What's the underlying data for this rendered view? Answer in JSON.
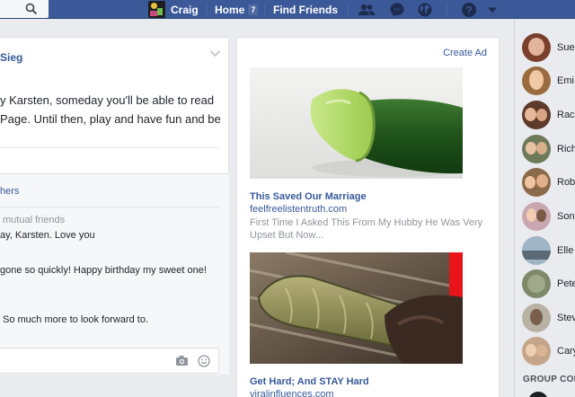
{
  "topbar": {
    "user_name": "Craig",
    "home_label": "Home",
    "home_count": "7",
    "find_friends_label": "Find Friends",
    "icons": [
      "search-icon",
      "friend-requests-icon",
      "messenger-icon",
      "notifications-globe-icon",
      "help-icon",
      "caret-down-icon"
    ]
  },
  "post": {
    "author": "Sieg",
    "text_line1": "y Karsten, someday you'll be able to read",
    "text_line2": "Page. Until then, play and have fun and be",
    "others_link": "hers",
    "mutual_friends": "mutual friends",
    "comments": [
      "ay, Karsten. Love you",
      "gone so quickly! Happy birthday my sweet one!",
      "So much more to look forward to."
    ]
  },
  "ads": {
    "create_ad_label": "Create Ad",
    "items": [
      {
        "title": "This Saved Our Marriage",
        "url": "feelfreelistentruth.com",
        "description": "First Time I Asked This From My Hubby He Was Very Upset But Now..."
      },
      {
        "title": "Get Hard; And STAY Hard",
        "url": "viralinfluences.com"
      }
    ]
  },
  "sidebar": {
    "contacts": [
      "Sue",
      "Emi",
      "Rac",
      "Rich",
      "Rob",
      "Son",
      "Elle",
      "Pete",
      "Stev",
      "Cary"
    ],
    "group_conversations_label": "GROUP CON"
  },
  "colors": {
    "brand_blue": "#3b5998",
    "link_blue": "#365899",
    "page_bg": "#e9ebee",
    "muted_text": "#90949c"
  }
}
